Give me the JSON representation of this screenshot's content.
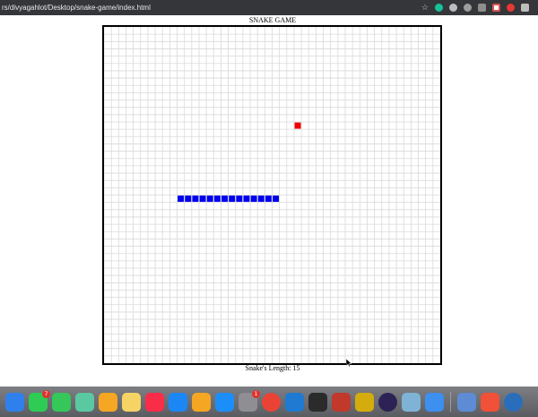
{
  "browser": {
    "url": "rs/divyagahlot/Desktop/snake-game/index.html",
    "extensions": [
      {
        "icon": "bookmark-star-icon",
        "color": "#c8c8c8"
      },
      {
        "icon": "grammarly-icon",
        "color": "#15c39a"
      },
      {
        "icon": "extension-shield-icon",
        "color": "#bdbdbd"
      },
      {
        "icon": "extension-chat-icon",
        "color": "#9e9e9e"
      },
      {
        "icon": "extension-chart-icon",
        "color": "#8d8d8d"
      },
      {
        "icon": "extension-red-square-icon",
        "color": "#d9534f"
      },
      {
        "icon": "extension-devtools-icon",
        "color": "#e53935"
      },
      {
        "icon": "extension-puzzle-icon",
        "color": "#bdbdbd"
      }
    ]
  },
  "game": {
    "title": "SNAKE GAME",
    "length_label": "Snake's Length: 15",
    "grid": {
      "cols": 46,
      "rows": 46
    },
    "snake": {
      "cells": [
        [
          10,
          23
        ],
        [
          11,
          23
        ],
        [
          12,
          23
        ],
        [
          13,
          23
        ],
        [
          14,
          23
        ],
        [
          15,
          23
        ],
        [
          16,
          23
        ],
        [
          17,
          23
        ],
        [
          18,
          23
        ],
        [
          19,
          23
        ],
        [
          20,
          23
        ],
        [
          21,
          23
        ],
        [
          22,
          23
        ],
        [
          23,
          23
        ]
      ],
      "color": "#0000ee"
    },
    "food": {
      "cell": [
        26,
        13
      ],
      "color": "#ee0000"
    },
    "grid_line_color": "#d9d9d9"
  },
  "dock": {
    "apps": [
      {
        "icon": "mail-partial-icon",
        "color": "#2f80ed"
      },
      {
        "icon": "facetime-icon",
        "color": "#2ecc55",
        "badge": "7"
      },
      {
        "icon": "messages-icon",
        "color": "#35c759"
      },
      {
        "icon": "maps-icon",
        "color": "#5ac8a0"
      },
      {
        "icon": "photos-icon",
        "color": "#f5a623"
      },
      {
        "icon": "notes-icon",
        "color": "#f6d365"
      },
      {
        "icon": "music-icon",
        "color": "#fa2d48"
      },
      {
        "icon": "keynote-icon",
        "color": "#1b87f5"
      },
      {
        "icon": "pages-icon",
        "color": "#f5a623"
      },
      {
        "icon": "app-store-icon",
        "color": "#1c8ef9"
      },
      {
        "icon": "system-preferences-icon",
        "color": "#8e8e93",
        "badge": "1"
      },
      {
        "icon": "chrome-icon",
        "color": "#ea4335"
      },
      {
        "icon": "vscode-icon",
        "color": "#1f7ad1"
      },
      {
        "icon": "terminal-icon",
        "color": "#2b2b2b"
      },
      {
        "icon": "solitaire-icon",
        "color": "#c0392b"
      },
      {
        "icon": "simulator-icon",
        "color": "#d4ac0d"
      },
      {
        "icon": "eclipse-icon",
        "color": "#2c2255"
      },
      {
        "icon": "preview-icon",
        "color": "#7fb3d5"
      },
      {
        "icon": "mail-icon",
        "color": "#3d8ff0"
      },
      {
        "icon": "finder-window-icon",
        "color": "#5d8bd4"
      },
      {
        "icon": "swift-playgrounds-icon",
        "color": "#f05138"
      },
      {
        "icon": "r-lang-icon",
        "color": "#2a6ebb"
      }
    ]
  }
}
